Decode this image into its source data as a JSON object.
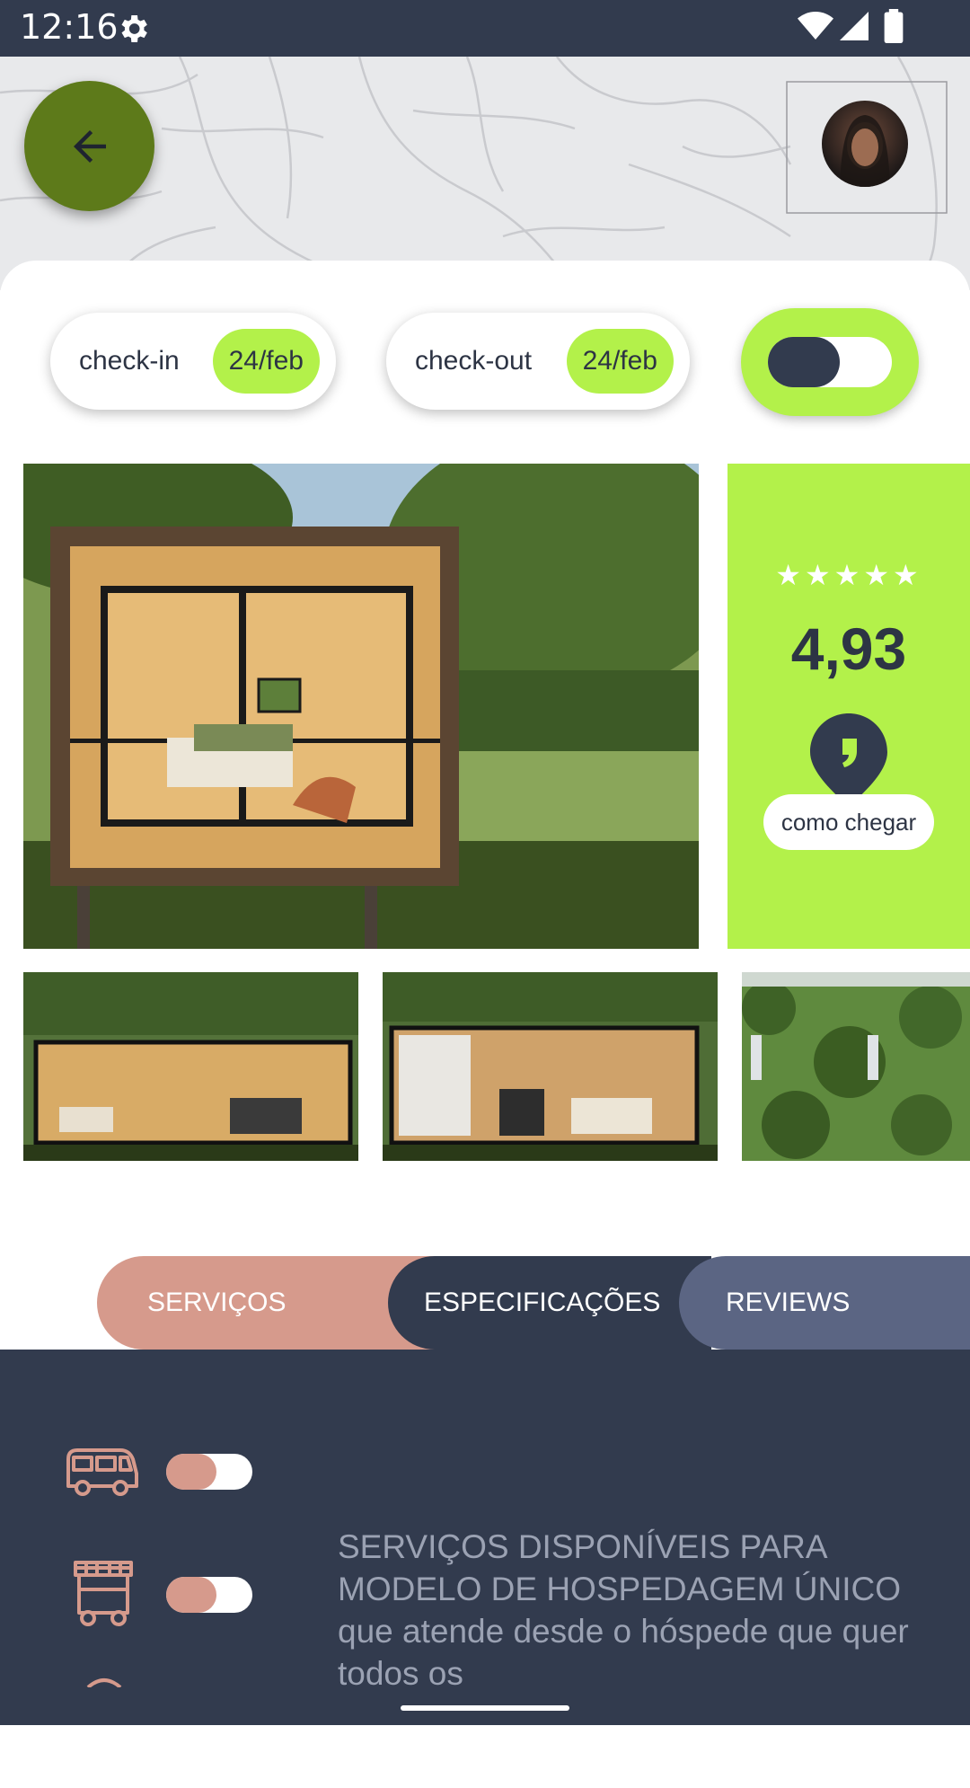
{
  "status_bar": {
    "time": "12:16"
  },
  "booking": {
    "checkin": {
      "label": "check-in",
      "date": "24/feb"
    },
    "checkout": {
      "label": "check-out",
      "date": "24/feb"
    }
  },
  "rating": {
    "stars": "★★★★★",
    "score": "4,93",
    "how_to_get": "como chegar"
  },
  "tabs": [
    {
      "label": "SERVIÇOS"
    },
    {
      "label": "ESPECIFICAÇÕES"
    },
    {
      "label": "REVIEWS"
    }
  ],
  "services": {
    "description": "SERVIÇOS  DISPONÍVEIS PARA MODELO DE HOSPEDAGEM ÚNICO que atende desde o hóspede que quer todos os"
  },
  "colors": {
    "dark": "#323b4e",
    "lime": "#b3f14a",
    "olive": "#5d7a1a",
    "salmon": "#d69a8c",
    "slate": "#5b6583"
  },
  "icons": [
    "settings-icon",
    "wifi-icon",
    "signal-icon",
    "battery-icon",
    "back-arrow-icon",
    "location-pin-icon",
    "bus-icon",
    "food-cart-icon"
  ]
}
